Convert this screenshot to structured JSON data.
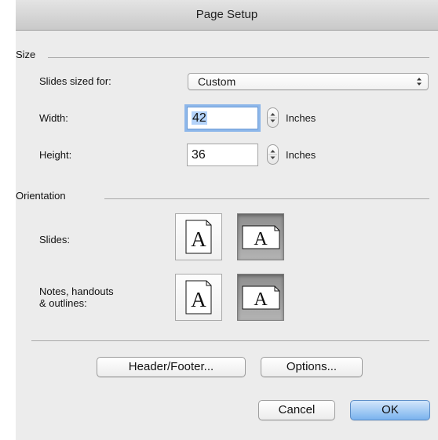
{
  "window": {
    "title": "Page Setup"
  },
  "size": {
    "section_label": "Size",
    "slides_sized_for_label": "Slides sized for:",
    "slides_sized_for_value": "Custom",
    "width_label": "Width:",
    "width_value": "42",
    "width_unit": "Inches",
    "height_label": "Height:",
    "height_value": "36",
    "height_unit": "Inches"
  },
  "orientation": {
    "section_label": "Orientation",
    "slides_label": "Slides:",
    "notes_label_line1": "Notes, handouts",
    "notes_label_line2": "& outlines:",
    "slides_selected": "landscape",
    "notes_selected": "landscape",
    "page_glyph": "A"
  },
  "buttons": {
    "header_footer": "Header/Footer...",
    "options": "Options...",
    "cancel": "Cancel",
    "ok": "OK"
  },
  "icons": {
    "popup": "up-down-arrows-icon",
    "stepper": "stepper-icon",
    "portrait": "portrait-page-icon",
    "landscape": "landscape-page-icon"
  },
  "colors": {
    "dialog_background": "#ececec",
    "focus_ring": "#8db7ea",
    "default_button": "#7ab3ee"
  }
}
